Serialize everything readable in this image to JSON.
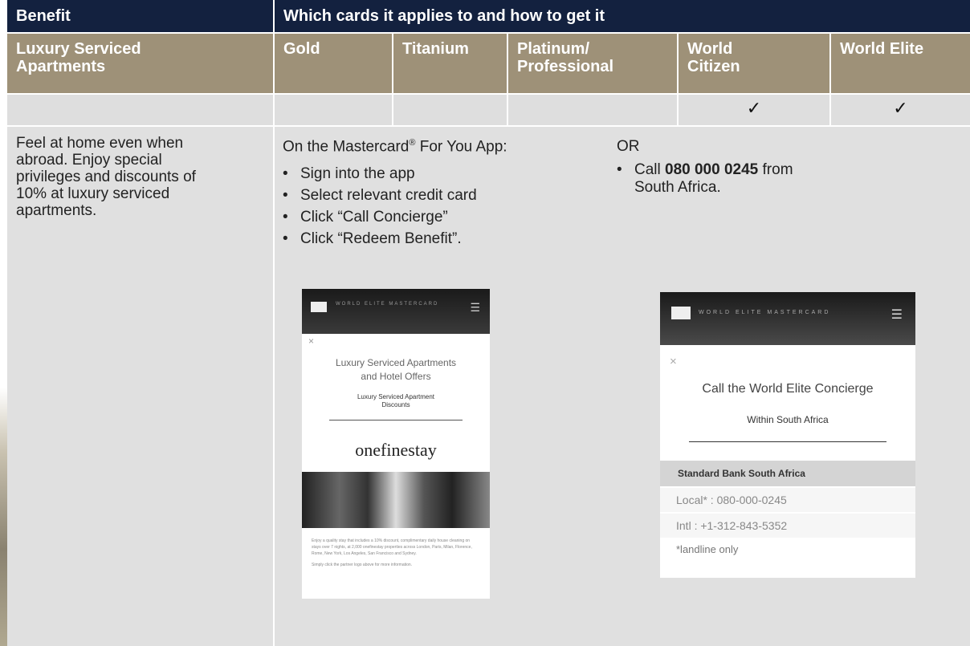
{
  "header": {
    "benefit": "Benefit",
    "which_cards": "Which cards it applies to and how to get it"
  },
  "subheader": {
    "benefit_name": "Luxury Serviced Apartments",
    "cards": [
      "Gold",
      "Titanium",
      "Platinum/ Professional",
      "World Citizen",
      "World Elite"
    ]
  },
  "applicability": {
    "gold": "",
    "titanium": "",
    "platinum": "",
    "world_citizen": "✓",
    "world_elite": "✓"
  },
  "description": "Feel at home even when abroad. Enjoy special privileges and discounts of 10% at luxury serviced apartments.",
  "app_steps": {
    "intro_prefix": "On the Mastercard",
    "intro_reg": "®",
    "intro_suffix": " For You App:",
    "steps": [
      "Sign into the app",
      "Select relevant credit card",
      "Click “Call Concierge”",
      "Click “Redeem Benefit”."
    ],
    "bullet": "•"
  },
  "alt_method": {
    "or": "OR",
    "bullet": "•",
    "call_prefix": "Call ",
    "phone": "080 000 0245",
    "call_suffix": " from",
    "call_line2": "South Africa."
  },
  "screenshot1": {
    "brand": "WORLD ELITE MASTERCARD",
    "menu_icon": "☰",
    "close": "×",
    "title_line1": "Luxury Serviced Apartments",
    "title_line2": "and Hotel Offers",
    "sub_line1": "Luxury Serviced Apartment",
    "sub_line2": "Discounts",
    "logo": "onefinestay",
    "body1": "Enjoy a quality stay that includes a 10% discount, complimentary daily house cleaning on stays over 7 nights, at 2,000 onefinestay properties across London, Paris, Milan, Florence, Rome, New York, Los Angeles, San Francisco and Sydney.",
    "body2": "Simply click the partner logo above for more information."
  },
  "screenshot2": {
    "brand": "WORLD ELITE MASTERCARD",
    "menu_icon": "☰",
    "close": "×",
    "title": "Call the World Elite Concierge",
    "subtitle": "Within South Africa",
    "bank": "Standard Bank South Africa",
    "local": "Local* : 080-000-0245",
    "intl": "Intl : +1-312-843-5352",
    "note": "*landline only"
  }
}
